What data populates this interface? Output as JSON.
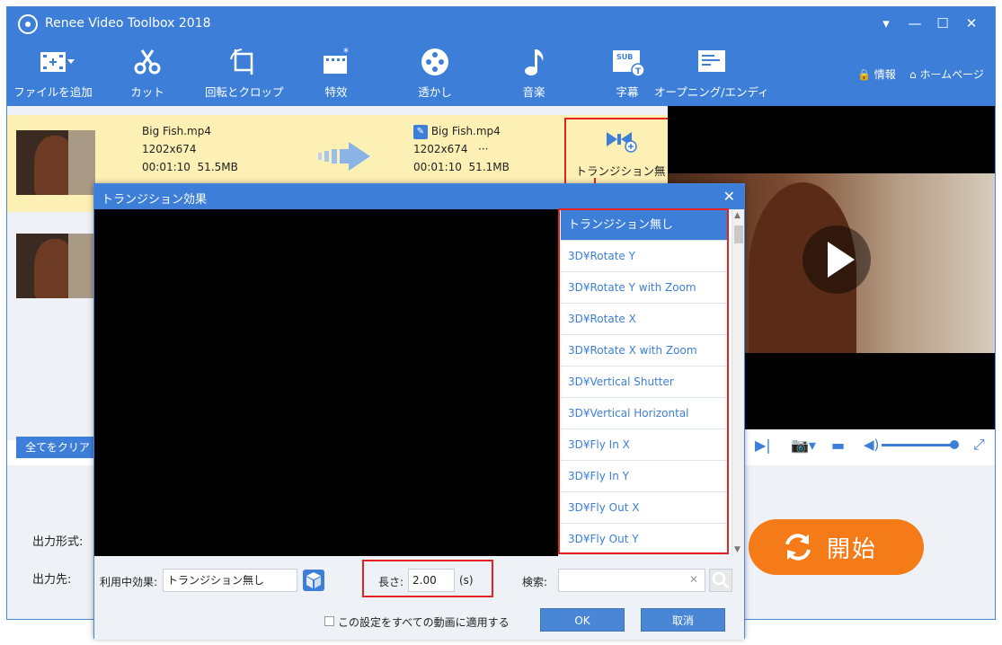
{
  "app": {
    "title": "Renee Video Toolbox 2018"
  },
  "window_controls": {
    "menu": "▾",
    "minimize": "—",
    "maximize": "☐",
    "close": "✕"
  },
  "toolbar": {
    "items": [
      {
        "label": "ファイルを追加",
        "icon": "add-file-icon"
      },
      {
        "label": "カット",
        "icon": "scissors-icon"
      },
      {
        "label": "回転とクロップ",
        "icon": "rotate-crop-icon"
      },
      {
        "label": "特效",
        "icon": "effects-icon"
      },
      {
        "label": "透かし",
        "icon": "watermark-icon"
      },
      {
        "label": "音楽",
        "icon": "music-icon"
      },
      {
        "label": "字幕",
        "icon": "subtitle-icon"
      },
      {
        "label": "オープニング/エンディ",
        "icon": "opening-ending-icon"
      }
    ],
    "info_label": "情報",
    "home_label": "ホームページ"
  },
  "file": {
    "source": {
      "name": "Big Fish.mp4",
      "resolution": "1202x674",
      "duration": "00:01:10",
      "size": "51.5MB"
    },
    "output": {
      "name": "Big Fish.mp4",
      "resolution": "1202x674",
      "more": "···",
      "duration": "00:01:10",
      "size": "51.1MB"
    },
    "transition_label": "トランジション無"
  },
  "clear_all": "全てをクリア",
  "output_format_label": "出力形式:",
  "output_dest_label": "出力先:",
  "start_label": "開始",
  "dialog": {
    "title": "トランジション効果",
    "effects": [
      "トランジション無し",
      "3D¥Rotate Y",
      "3D¥Rotate Y with Zoom",
      "3D¥Rotate X",
      "3D¥Rotate X with Zoom",
      "3D¥Vertical Shutter",
      "3D¥Vertical Horizontal",
      "3D¥Fly In X",
      "3D¥Fly In Y",
      "3D¥Fly Out X",
      "3D¥Fly Out Y"
    ],
    "current_effect_label": "利用中効果:",
    "current_effect_value": "トランジション無し",
    "length_label": "長さ:",
    "length_value": "2.00",
    "length_unit": "(s)",
    "search_label": "検索:",
    "search_value": "",
    "search_clear": "✕",
    "apply_all_label": "この設定をすべての動画に適用する",
    "ok_label": "OK",
    "cancel_label": "取消"
  },
  "colors": {
    "primary": "#3d7fd8",
    "highlight_row": "#fdf0b5",
    "start": "#f47b17",
    "annotation": "#e52222"
  }
}
